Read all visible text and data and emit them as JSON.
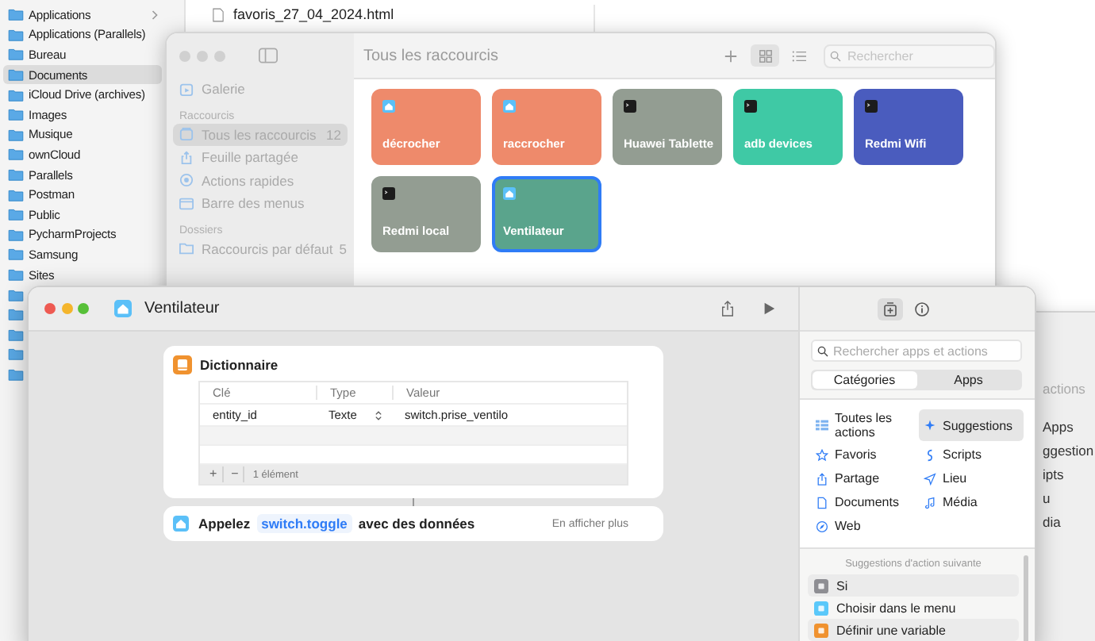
{
  "finder": {
    "sidebar": [
      {
        "label": "Applications",
        "selected": false,
        "expandable": true
      },
      {
        "label": "Applications (Parallels)",
        "selected": false,
        "expandable": false
      },
      {
        "label": "Bureau",
        "selected": false,
        "expandable": false
      },
      {
        "label": "Documents",
        "selected": true,
        "expandable": false
      },
      {
        "label": "iCloud Drive (archives)",
        "selected": false,
        "expandable": false
      },
      {
        "label": "Images",
        "selected": false,
        "expandable": false
      },
      {
        "label": "Musique",
        "selected": false,
        "expandable": false
      },
      {
        "label": "ownCloud",
        "selected": false,
        "expandable": false
      },
      {
        "label": "Parallels",
        "selected": false,
        "expandable": false
      },
      {
        "label": "Postman",
        "selected": false,
        "expandable": false
      },
      {
        "label": "Public",
        "selected": false,
        "expandable": false
      },
      {
        "label": "PycharmProjects",
        "selected": false,
        "expandable": false
      },
      {
        "label": "Samsung",
        "selected": false,
        "expandable": false
      },
      {
        "label": "Sites",
        "selected": false,
        "expandable": false
      },
      {
        "selected": false
      },
      {
        "selected": false
      },
      {
        "selected": false
      },
      {
        "selected": false
      },
      {
        "selected": false
      }
    ],
    "files": [
      {
        "name": "favoris_27_04_2024.html"
      }
    ]
  },
  "shortcuts": {
    "title": "Tous les raccourcis",
    "views": [
      {
        "selected": true
      },
      {
        "selected": false
      }
    ],
    "search": {
      "placeholder": "Rechercher"
    },
    "top_items": [
      {
        "label": "Galerie",
        "selected": false
      }
    ],
    "sections": [
      {
        "title": "Raccourcis",
        "items": [
          {
            "label": "Tous les raccourcis",
            "count": "12",
            "selected": true
          },
          {
            "label": "Feuille partagée",
            "selected": false
          },
          {
            "label": "Actions rapides",
            "selected": false
          },
          {
            "label": "Barre des menus",
            "selected": false
          }
        ]
      },
      {
        "title": "Dossiers",
        "items": [
          {
            "label": "Raccourcis par défaut",
            "count": "5",
            "selected": false
          }
        ]
      }
    ],
    "tiles": [
      {
        "name": "décrocher",
        "kind": "home",
        "color": "#ee8a6b",
        "selected": false
      },
      {
        "name": "raccrocher",
        "kind": "home",
        "color": "#ee8a6b",
        "selected": false
      },
      {
        "name": "Huawei Tablette",
        "kind": "terminal",
        "color": "#939d92",
        "selected": false
      },
      {
        "name": "adb devices",
        "kind": "terminal",
        "color": "#3fc9a5",
        "selected": false
      },
      {
        "name": "Redmi Wifi",
        "kind": "terminal",
        "color": "#4a5cbe",
        "selected": false
      },
      {
        "name": "Redmi local",
        "kind": "terminal",
        "color": "#939d92",
        "selected": false
      },
      {
        "name": "Ventilateur",
        "kind": "home",
        "color": "#5aa48c",
        "selected": true
      }
    ]
  },
  "editor": {
    "title": "Ventilateur",
    "actions": [
      {
        "kind": "dictionary",
        "title": "Dictionnaire",
        "columns": [
          "Clé",
          "Type",
          "Valeur"
        ],
        "rows": [
          {
            "key": "entity_id",
            "type": "Texte",
            "value": "switch.prise_ventilo"
          }
        ],
        "add": "+",
        "remove": "−",
        "count": "1 élément"
      },
      {
        "kind": "call",
        "label": "Appelez",
        "token": "switch.toggle",
        "suffix": "avec des données",
        "more": "En afficher plus"
      }
    ],
    "panel_tabs": [
      {
        "selected": true
      },
      {
        "selected": false
      }
    ],
    "search": {
      "placeholder": "Rechercher apps et actions"
    },
    "segments": [
      {
        "label": "Catégories",
        "selected": true
      },
      {
        "label": "Apps",
        "selected": false
      }
    ],
    "categories": [
      {
        "label": "Toutes les actions",
        "selected": false
      },
      {
        "label": "Suggestions",
        "selected": true
      },
      {
        "label": "Favoris",
        "selected": false
      },
      {
        "label": "Scripts",
        "selected": false
      },
      {
        "label": "Partage",
        "selected": false
      },
      {
        "label": "Lieu",
        "selected": false
      },
      {
        "label": "Documents",
        "selected": false
      },
      {
        "label": "Média",
        "selected": false
      },
      {
        "label": "Web",
        "selected": false
      }
    ],
    "suggestions": {
      "title": "Suggestions d'action suivante",
      "items": [
        {
          "label": "Si"
        },
        {
          "label": "Choisir dans le menu"
        },
        {
          "label": "Définir une variable"
        }
      ]
    }
  },
  "back_window": {
    "texts": [
      "actions",
      "Apps",
      "ggestion",
      "ipts",
      "u",
      "dia"
    ]
  }
}
